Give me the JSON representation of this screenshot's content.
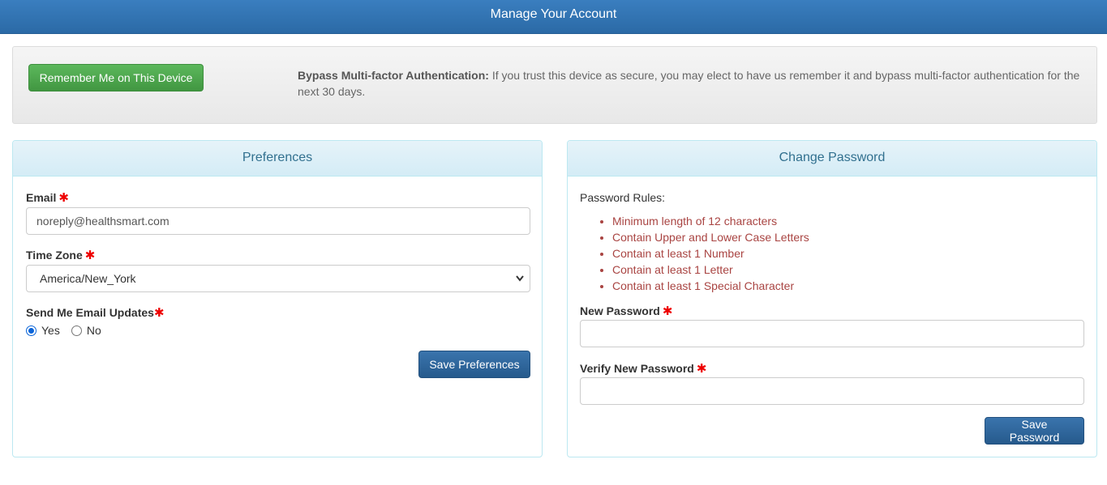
{
  "header": {
    "title": "Manage Your Account"
  },
  "mfa": {
    "button_label": "Remember Me on This Device",
    "bold_label": "Bypass Multi-factor Authentication:",
    "description": " If you trust this device as secure, you may elect to have us remember it and bypass multi-factor authentication for the next 30 days."
  },
  "preferences": {
    "title": "Preferences",
    "email_label": "Email",
    "email_value": "noreply@healthsmart.com",
    "timezone_label": "Time Zone",
    "timezone_value": "America/New_York",
    "updates_label": "Send Me Email Updates",
    "options": [
      "Yes",
      "No"
    ],
    "selected": "Yes",
    "save_label": "Save Preferences"
  },
  "password": {
    "title": "Change Password",
    "rules_title": "Password Rules:",
    "rules": [
      "Minimum length of 12 characters",
      "Contain Upper and Lower Case Letters",
      "Contain at least 1 Number",
      "Contain at least 1 Letter",
      "Contain at least 1 Special Character"
    ],
    "new_label": "New Password",
    "new_value": "",
    "verify_label": "Verify New Password",
    "verify_value": "",
    "save_label": "Save Password"
  },
  "required_marker": "✱",
  "icons": {
    "required": "asterisk-icon",
    "select": "chevron-down-icon"
  },
  "colors": {
    "header": "#2f70ad",
    "accent_green": "#4cae4c",
    "required": "#e00000",
    "rules": "#a94442"
  }
}
